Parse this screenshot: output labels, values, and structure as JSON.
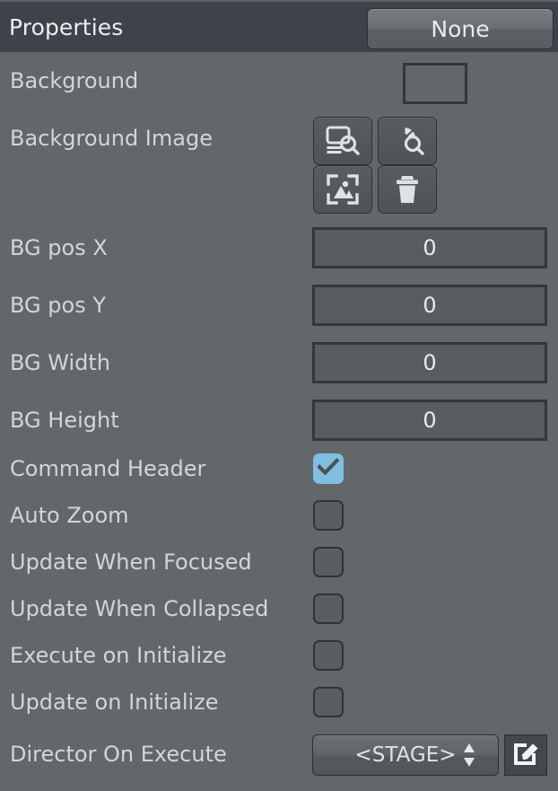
{
  "header": {
    "title": "Properties",
    "selector_label": "None"
  },
  "rows": [
    {
      "label": "Background",
      "type": "color",
      "value": "#62676a"
    },
    {
      "label": "Background Image",
      "type": "iconbuttons"
    },
    {
      "label": "BG pos X",
      "type": "number",
      "value": "0"
    },
    {
      "label": "BG pos Y",
      "type": "number",
      "value": "0"
    },
    {
      "label": "BG Width",
      "type": "number",
      "value": "0"
    },
    {
      "label": "BG Height",
      "type": "number",
      "value": "0"
    },
    {
      "label": "Command Header",
      "type": "checkbox",
      "checked": true
    },
    {
      "label": "Auto Zoom",
      "type": "checkbox",
      "checked": false
    },
    {
      "label": "Update When Focused",
      "type": "checkbox",
      "checked": false
    },
    {
      "label": "Update When Collapsed",
      "type": "checkbox",
      "checked": false
    },
    {
      "label": "Execute on Initialize",
      "type": "checkbox",
      "checked": false
    },
    {
      "label": "Update on Initialize",
      "type": "checkbox",
      "checked": false
    },
    {
      "label": "Director On Execute",
      "type": "select",
      "value": "<STAGE>"
    }
  ],
  "icons": {
    "screen_search": "screen-search-icon",
    "pie_search": "pie-search-icon",
    "image_frame": "image-frame-icon",
    "trash": "trash-icon",
    "edit": "edit-icon",
    "spinner": "spinner-up-down-icon",
    "check": "check-icon"
  },
  "colors": {
    "panel_bg": "#62676a",
    "header_bg": "#3d4348",
    "checkbox_on": "#80bfe2",
    "field_bg": "#585d61",
    "border_dark": "#32373b",
    "label_text": "#d2d6d8"
  }
}
